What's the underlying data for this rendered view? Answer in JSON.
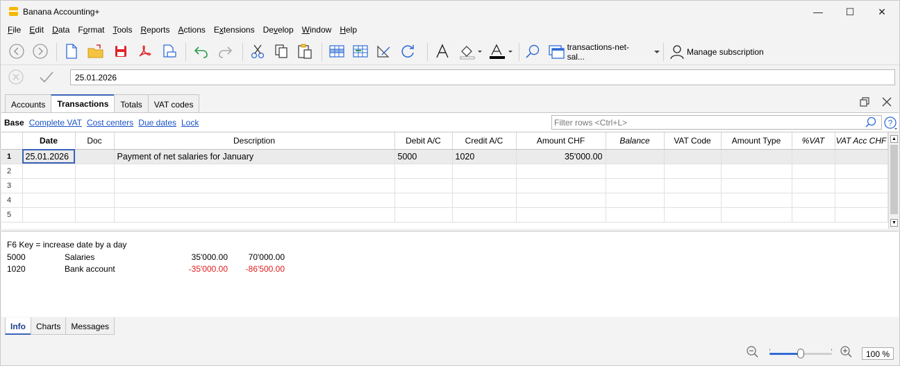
{
  "window": {
    "title": "Banana Accounting+",
    "minimize": "—",
    "maximize": "☐",
    "close": "✕"
  },
  "menu": [
    {
      "pre": "",
      "u": "F",
      "post": "ile"
    },
    {
      "pre": "",
      "u": "E",
      "post": "dit"
    },
    {
      "pre": "",
      "u": "D",
      "post": "ata"
    },
    {
      "pre": "F",
      "u": "o",
      "post": "rmat"
    },
    {
      "pre": "",
      "u": "T",
      "post": "ools"
    },
    {
      "pre": "",
      "u": "R",
      "post": "eports"
    },
    {
      "pre": "",
      "u": "A",
      "post": "ctions"
    },
    {
      "pre": "E",
      "u": "x",
      "post": "tensions"
    },
    {
      "pre": "De",
      "u": "v",
      "post": "elop"
    },
    {
      "pre": "",
      "u": "W",
      "post": "indow"
    },
    {
      "pre": "",
      "u": "H",
      "post": "elp"
    }
  ],
  "toolbar": {
    "file_name": "transactions-net-sal...",
    "subscription": "Manage subscription",
    "brand_red": "#e0242c",
    "accent_blue": "#2f6bd6"
  },
  "edit": {
    "value": "25.01.2026"
  },
  "tabs": [
    "Accounts",
    "Transactions",
    "Totals",
    "VAT codes"
  ],
  "views": [
    "Base",
    "Complete VAT",
    "Cost centers",
    "Due dates",
    "Lock"
  ],
  "filter": {
    "placeholder": "Filter rows <Ctrl+L>"
  },
  "table": {
    "columns": [
      "Date",
      "Doc",
      "Description",
      "Debit A/C",
      "Credit A/C",
      "Amount CHF",
      "Balance",
      "VAT Code",
      "Amount Type",
      "%VAT",
      "VAT Acc CHF"
    ],
    "rows": [
      {
        "n": "1",
        "date": "25.01.2026",
        "doc": "",
        "desc": "Payment of net salaries for January",
        "debit": "5000",
        "credit": "1020",
        "amount": "35'000.00",
        "balance": "",
        "vatcode": "",
        "amttype": "",
        "pvat": "",
        "vatacc": ""
      },
      {
        "n": "2",
        "date": "",
        "doc": "",
        "desc": "",
        "debit": "",
        "credit": "",
        "amount": "",
        "balance": "",
        "vatcode": "",
        "amttype": "",
        "pvat": "",
        "vatacc": ""
      },
      {
        "n": "3",
        "date": "",
        "doc": "",
        "desc": "",
        "debit": "",
        "credit": "",
        "amount": "",
        "balance": "",
        "vatcode": "",
        "amttype": "",
        "pvat": "",
        "vatacc": ""
      },
      {
        "n": "4",
        "date": "",
        "doc": "",
        "desc": "",
        "debit": "",
        "credit": "",
        "amount": "",
        "balance": "",
        "vatcode": "",
        "amttype": "",
        "pvat": "",
        "vatacc": ""
      },
      {
        "n": "5",
        "date": "",
        "doc": "",
        "desc": "",
        "debit": "",
        "credit": "",
        "amount": "",
        "balance": "",
        "vatcode": "",
        "amttype": "",
        "pvat": "",
        "vatacc": ""
      }
    ]
  },
  "info": {
    "hint": "F6 Key = increase date by a day",
    "lines": [
      {
        "account": "5000",
        "desc": "Salaries",
        "amount": "35'000.00",
        "balance": "70'000.00",
        "negative": false
      },
      {
        "account": "1020",
        "desc": "Bank account",
        "amount": "-35'000.00",
        "balance": "-86'500.00",
        "negative": true
      }
    ]
  },
  "bottom_tabs": [
    "Info",
    "Charts",
    "Messages"
  ],
  "zoom": {
    "value": "100 %",
    "level_fraction": 0.5
  }
}
